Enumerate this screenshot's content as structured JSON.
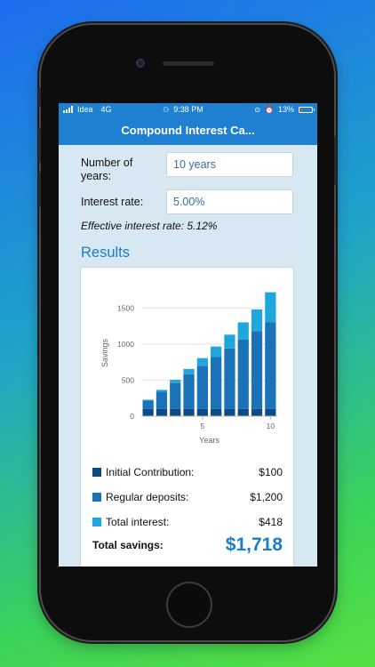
{
  "status_bar": {
    "carrier": "Idea",
    "network": "4G",
    "time": "9:38 PM",
    "battery": "13%"
  },
  "app": {
    "title": "Compound Interest Ca..."
  },
  "form": {
    "years_label": "Number of years:",
    "years_value": "10 years",
    "rate_label": "Interest rate:",
    "rate_value": "5.00%",
    "effective_rate": "Effective interest rate: 5.12%"
  },
  "results": {
    "title": "Results",
    "legend": [
      {
        "label": "Initial Contribution:",
        "value": "$100",
        "color": "#0e4a86"
      },
      {
        "label": "Regular deposits:",
        "value": "$1,200",
        "color": "#1a72b8"
      },
      {
        "label": "Total interest:",
        "value": "$418",
        "color": "#1fa6dc"
      }
    ],
    "total_label": "Total savings:",
    "total_value": "$1,718"
  },
  "colors": {
    "accent": "#1f7fd0",
    "initial": "#0e4a86",
    "deposits": "#1a72b8",
    "interest": "#1fa6dc"
  },
  "chart_data": {
    "type": "bar",
    "stacked": true,
    "categories": [
      1,
      2,
      3,
      4,
      5,
      6,
      7,
      8,
      9,
      10
    ],
    "series": [
      {
        "name": "Initial Contribution",
        "values": [
          100,
          100,
          100,
          100,
          100,
          100,
          100,
          100,
          100,
          100
        ]
      },
      {
        "name": "Regular deposits",
        "values": [
          120,
          240,
          360,
          480,
          600,
          720,
          840,
          960,
          1080,
          1200
        ]
      },
      {
        "name": "Total interest",
        "values": [
          8,
          25,
          45,
          75,
          105,
          145,
          190,
          240,
          300,
          418
        ]
      }
    ],
    "x_ticks": [
      "5",
      "10"
    ],
    "y_ticks": [
      "0",
      "500",
      "1000",
      "1500"
    ],
    "xlabel": "Years",
    "ylabel": "Savings",
    "ylim": [
      0,
      1750
    ],
    "grid": true
  }
}
